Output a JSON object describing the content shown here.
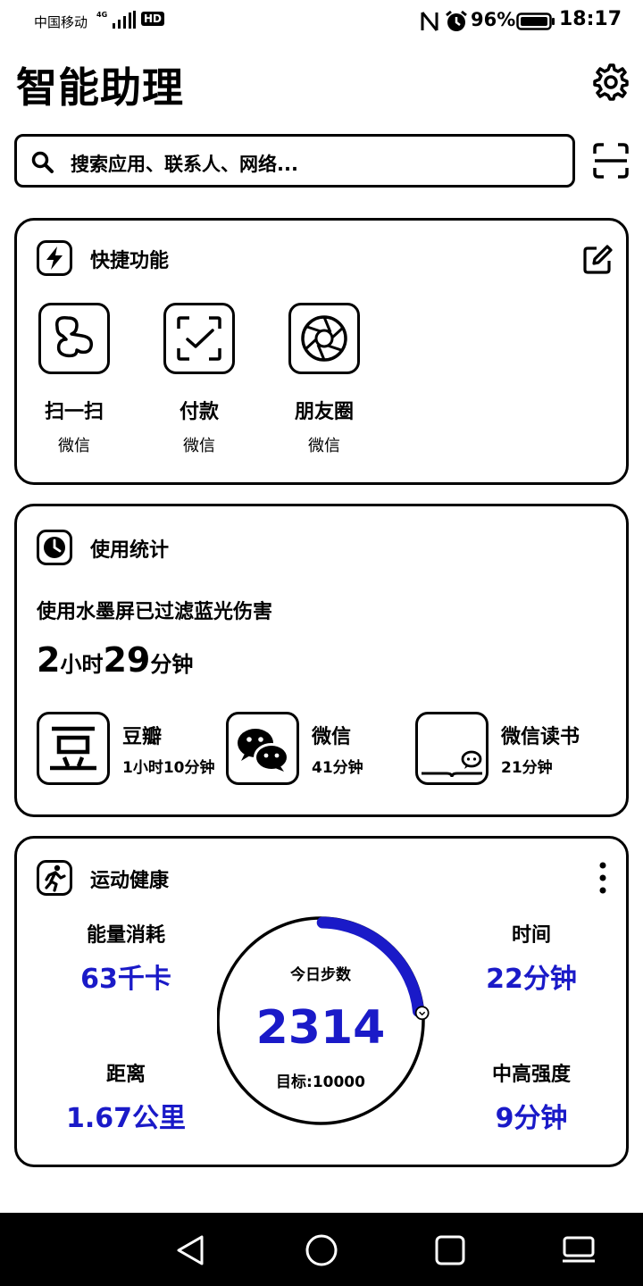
{
  "status_bar": {
    "carrier": "中国移动",
    "network": "4G",
    "hd": "HD",
    "battery_percent": "96%",
    "time": "18:17"
  },
  "header": {
    "title": "智能助理",
    "settings_icon": "gear-icon"
  },
  "search": {
    "placeholder": "搜索应用、联系人、网络...",
    "scan_icon": "scan-icon"
  },
  "quick_functions": {
    "title": "快捷功能",
    "items": [
      {
        "label": "扫一扫",
        "app": "微信",
        "icon": "scan-wechat-icon"
      },
      {
        "label": "付款",
        "app": "微信",
        "icon": "payment-icon"
      },
      {
        "label": "朋友圈",
        "app": "微信",
        "icon": "moments-icon"
      }
    ]
  },
  "usage": {
    "title": "使用统计",
    "description": "使用水墨屏已过滤蓝光伤害",
    "hours": "2",
    "hours_unit": "小时",
    "minutes": "29",
    "minutes_unit": "分钟",
    "apps": [
      {
        "name": "豆瓣",
        "duration": "1小时10分钟",
        "icon": "douban-icon"
      },
      {
        "name": "微信",
        "duration": "41分钟",
        "icon": "wechat-icon"
      },
      {
        "name": "微信读书",
        "duration": "21分钟",
        "icon": "wechat-read-icon"
      }
    ]
  },
  "health": {
    "title": "运动健康",
    "energy": {
      "label": "能量消耗",
      "value": "63千卡"
    },
    "distance": {
      "label": "距离",
      "value": "1.67公里"
    },
    "time": {
      "label": "时间",
      "value": "22分钟"
    },
    "intensity": {
      "label": "中高强度",
      "value": "9分钟"
    },
    "steps": {
      "label": "今日步数",
      "value": "2314",
      "goal": "目标:10000",
      "progress": 0.2314
    },
    "accent_color": "#1a1ac8"
  },
  "nav": {
    "back_icon": "back-triangle-icon",
    "home_icon": "home-circle-icon",
    "recents_icon": "recents-square-icon",
    "desktop_icon": "desktop-icon"
  }
}
